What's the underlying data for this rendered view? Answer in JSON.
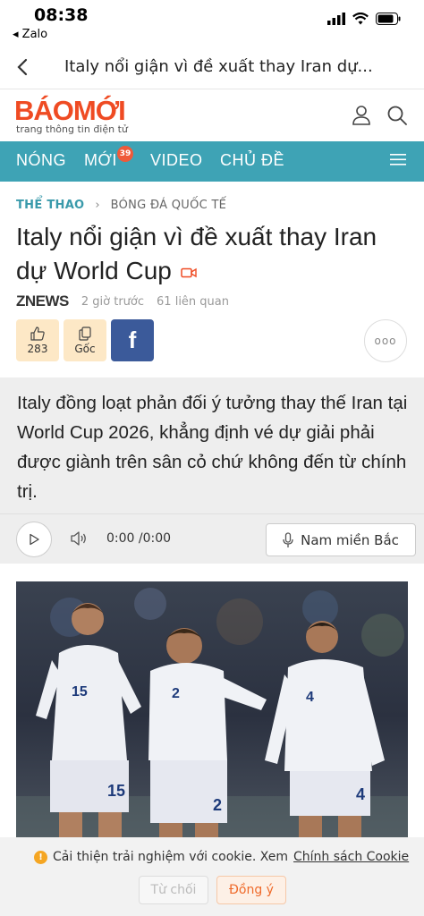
{
  "status_bar": {
    "time": "08:38",
    "back_app": "◂ Zalo"
  },
  "nav": {
    "title": "Italy nổi giận vì đề xuất thay Iran dự..."
  },
  "brand": {
    "logo": "BÁOMỚI",
    "tagline": "trang thông tin điện tử",
    "accent": "#ef4b23"
  },
  "menu": {
    "items": [
      "NÓNG",
      "MỚI",
      "VIDEO",
      "CHỦ ĐỀ"
    ],
    "new_badge": "39",
    "bg": "#3ea3b5"
  },
  "breadcrumb": {
    "category": "THỂ THAO",
    "subcategory": "BÓNG ĐÁ QUỐC TẾ"
  },
  "article": {
    "title": "Italy nổi giận vì đề xuất thay Iran dự World Cup",
    "source": "ZNEWS",
    "time_ago": "2 giờ trước",
    "related": "61 liên quan",
    "like_count": "283",
    "origin_label": "Gốc",
    "facebook_label": "f",
    "more_label": "ooo",
    "summary": "Italy đồng loạt phản đối ý tưởng thay thế Iran tại World Cup 2026, khẳng định vé dự giải phải được giành trên sân cỏ chứ không đến từ chính trị."
  },
  "audio": {
    "time": "0:00 /0:00",
    "voice": "Nam miền Bắc"
  },
  "photo": {
    "jersey_numbers": [
      "15",
      "2",
      "4"
    ]
  },
  "cookie": {
    "message": "Cải thiện trải nghiệm với cookie. Xem",
    "link": "Chính sách Cookie",
    "reject": "Từ chối",
    "accept": "Đồng ý"
  },
  "icons": [
    "signal-icon",
    "wifi-icon",
    "battery-icon",
    "back-chevron-icon",
    "user-icon",
    "search-icon",
    "menu-icon",
    "video-icon",
    "like-icon",
    "copy-icon",
    "play-icon",
    "volume-icon",
    "mic-icon",
    "info-icon"
  ]
}
